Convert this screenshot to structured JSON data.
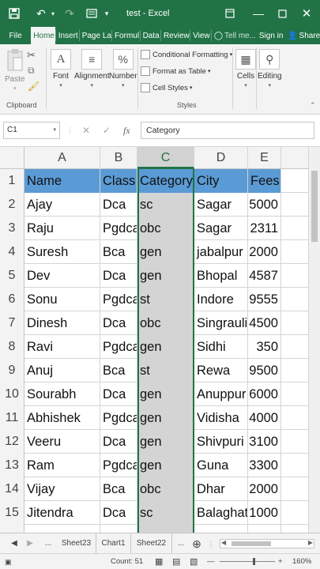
{
  "titlebar": {
    "title": "test - Excel",
    "save_icon": "save-icon",
    "undo_icon": "undo-icon",
    "redo_icon": "redo-icon",
    "customize_icon": "customize-icon"
  },
  "tabs": [
    "File",
    "Home",
    "Insert",
    "Page La",
    "Formul",
    "Data",
    "Review",
    "View",
    "Tell me...",
    "Sign in",
    "Share"
  ],
  "ribbon": {
    "paste": "Paste",
    "clipboard_label": "Clipboard",
    "font": "Font",
    "alignment": "Alignment",
    "number": "Number",
    "conditional_formatting": "Conditional Formatting",
    "format_as_table": "Format as Table",
    "cell_styles": "Cell Styles",
    "styles_label": "Styles",
    "cells": "Cells",
    "editing": "Editing"
  },
  "formula_bar": {
    "name_box": "C1",
    "fx": "fx",
    "value": "Category"
  },
  "sheet": {
    "columns": [
      "A",
      "B",
      "C",
      "D",
      "E"
    ],
    "selected_column": "C",
    "row_numbers": [
      "1",
      "2",
      "3",
      "4",
      "5",
      "6",
      "7",
      "8",
      "9",
      "10",
      "11",
      "12",
      "13",
      "14",
      "15"
    ],
    "header": [
      "Name",
      "Class",
      "Category",
      "City",
      "Fees"
    ],
    "rows": [
      [
        "Ajay",
        "Dca",
        "sc",
        "Sagar",
        "5000"
      ],
      [
        "Raju",
        "Pgdca",
        "obc",
        "Sagar",
        "2311"
      ],
      [
        "Suresh",
        "Bca",
        "gen",
        "jabalpur",
        "2000"
      ],
      [
        "Dev",
        "Dca",
        "gen",
        "Bhopal",
        "4587"
      ],
      [
        "Sonu",
        "Pgdca",
        "st",
        "Indore",
        "9555"
      ],
      [
        "Dinesh",
        "Dca",
        "obc",
        "Singrauli",
        "4500"
      ],
      [
        "Ravi",
        "Pgdca",
        "gen",
        "Sidhi",
        "350"
      ],
      [
        "Anuj",
        "Bca",
        "st",
        "Rewa",
        "9500"
      ],
      [
        "Sourabh",
        "Dca",
        "gen",
        "Anuppur",
        "6000"
      ],
      [
        "Abhishek",
        "Pgdca",
        "gen",
        "Vidisha",
        "4000"
      ],
      [
        "Veeru",
        "Dca",
        "gen",
        "Shivpuri",
        "3100"
      ],
      [
        "Ram",
        "Pgdca",
        "gen",
        "Guna",
        "3300"
      ],
      [
        "Vijay",
        "Bca",
        "obc",
        "Dhar",
        "2000"
      ],
      [
        "Jitendra",
        "Dca",
        "sc",
        "Balaghat",
        "1000"
      ]
    ],
    "header_color": "#5b9bd5",
    "accent_color": "#217346"
  },
  "sheet_tabs": [
    "Sheet23",
    "Chart1",
    "Sheet22"
  ],
  "ellipsis": "...",
  "status": {
    "count": "Count: 51",
    "zoom": "160%"
  }
}
